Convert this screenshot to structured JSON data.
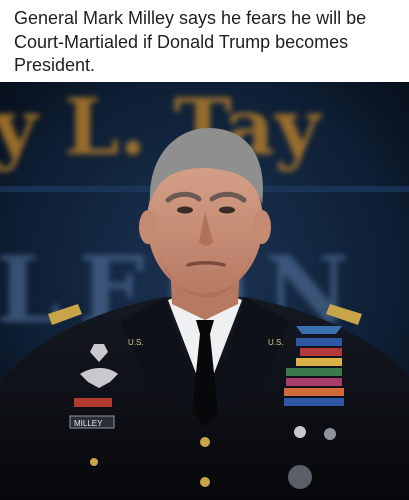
{
  "post": {
    "caption": "General Mark Milley says he fears he will be Court-Martialed if Donald Trump becomes President."
  },
  "photo": {
    "backdrop_text_top": "y L. Tay",
    "backdrop_text_bottom": "LEON",
    "name_tag": "MILLEY",
    "lapel_insignia": "U.S.",
    "colors": {
      "backdrop_dark": "#0b1a2b",
      "backdrop_gold": "#b07a2c",
      "backdrop_steel": "#5a7aa6",
      "uniform": "#0c0e13",
      "shirt": "#eef0f2",
      "skin": "#c98f78",
      "hair": "#8f8f8f"
    }
  }
}
